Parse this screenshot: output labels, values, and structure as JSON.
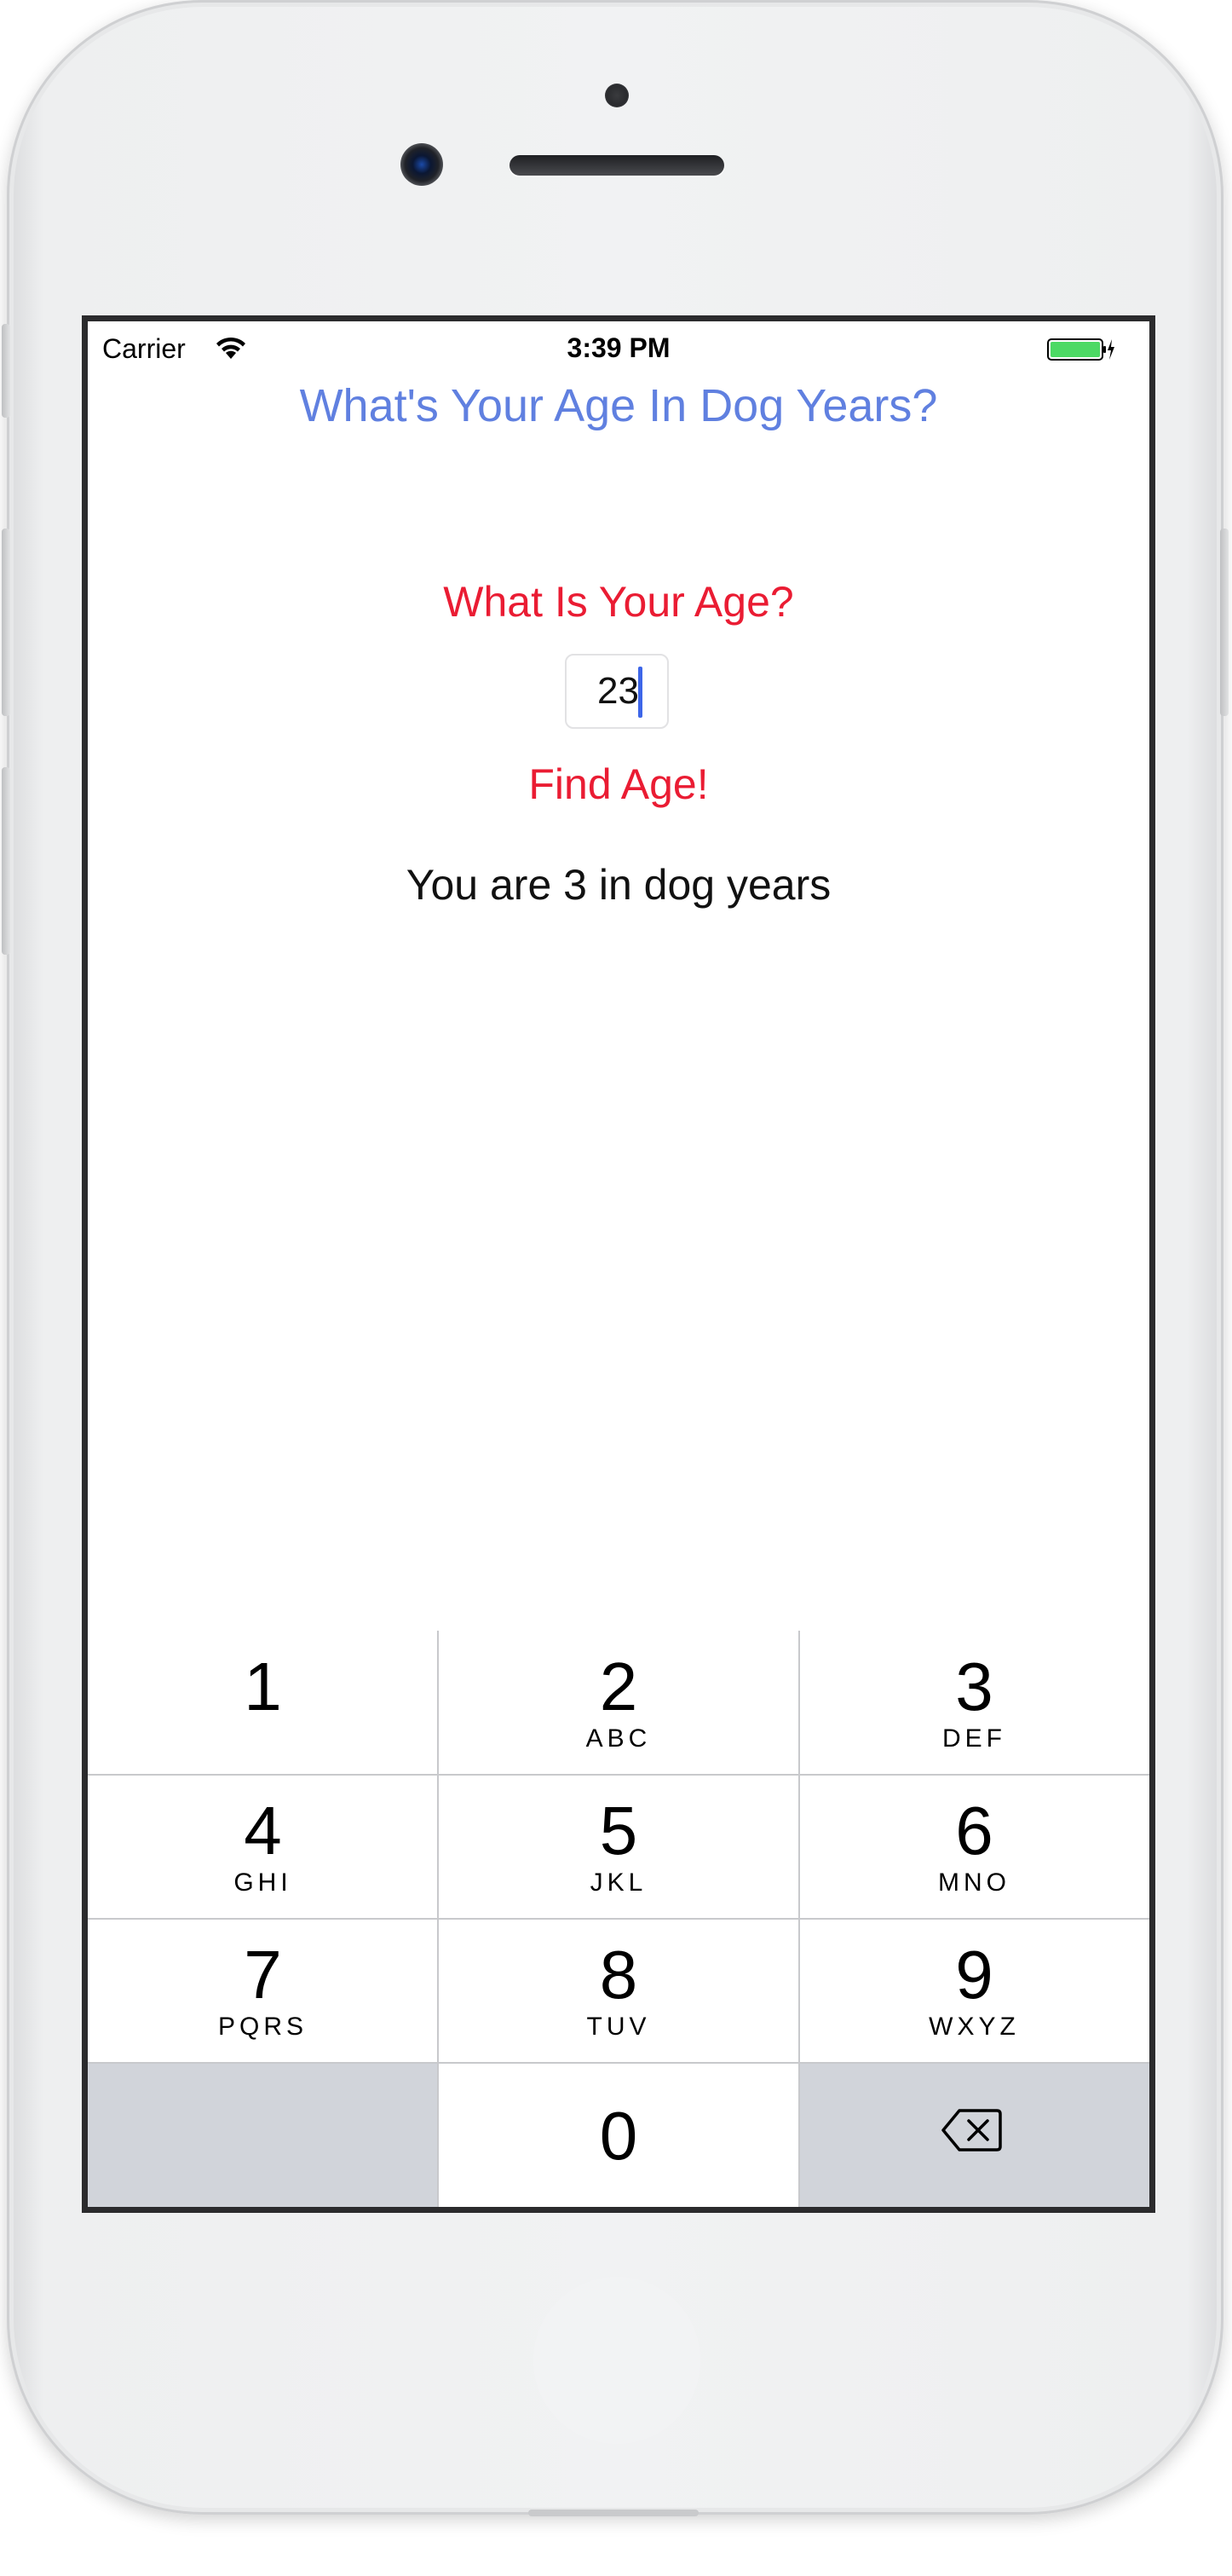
{
  "status_bar": {
    "carrier": "Carrier",
    "time": "3:39 PM",
    "wifi_icon": "wifi-icon",
    "battery_icon": "battery-charging-icon",
    "battery_color": "#4cd964"
  },
  "app": {
    "title": "What's Your Age In Dog Years?",
    "question": "What Is Your Age?",
    "age_input_value": "23",
    "find_button_label": "Find Age!",
    "result_text": "You are 3 in dog years",
    "title_color": "#6080e0",
    "accent_color": "#ea1c33"
  },
  "keypad": {
    "keys": [
      {
        "digit": "1",
        "letters": ""
      },
      {
        "digit": "2",
        "letters": "ABC"
      },
      {
        "digit": "3",
        "letters": "DEF"
      },
      {
        "digit": "4",
        "letters": "GHI"
      },
      {
        "digit": "5",
        "letters": "JKL"
      },
      {
        "digit": "6",
        "letters": "MNO"
      },
      {
        "digit": "7",
        "letters": "PQRS"
      },
      {
        "digit": "8",
        "letters": "TUV"
      },
      {
        "digit": "9",
        "letters": "WXYZ"
      },
      {
        "digit": "0",
        "letters": ""
      }
    ],
    "delete_icon": "backspace-icon"
  },
  "device": {
    "home_button_icon": "home-button"
  }
}
